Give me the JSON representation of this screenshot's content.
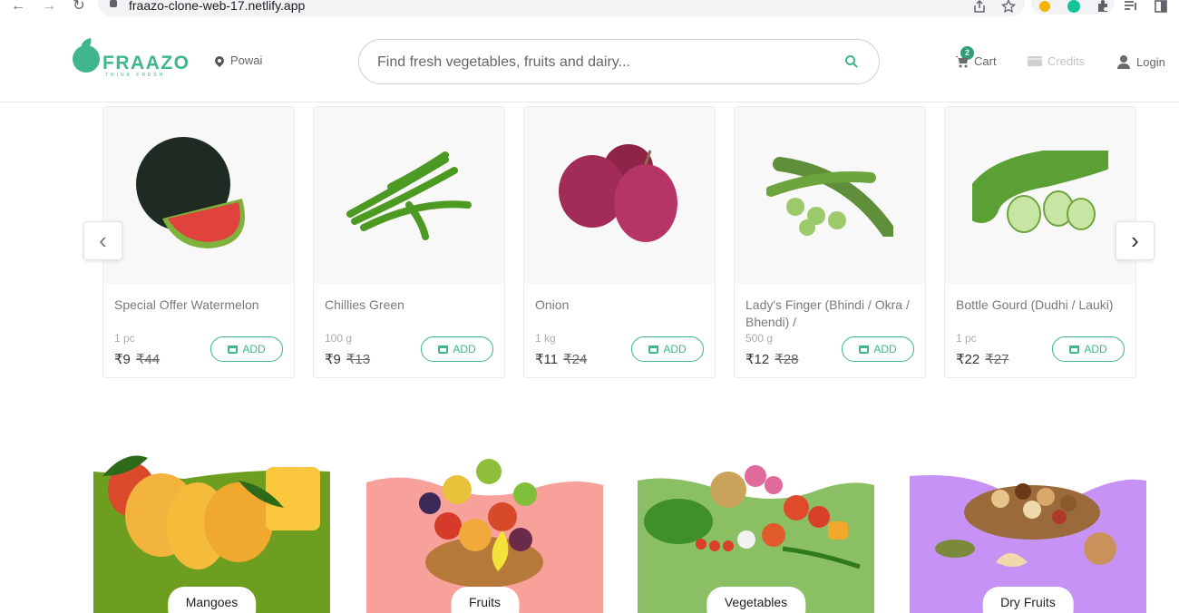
{
  "browser": {
    "url": "fraazo-clone-web-17.netlify.app",
    "back_glyph": "←",
    "forward_glyph": "→",
    "reload_glyph": "↻"
  },
  "header": {
    "brand": "FRAAZO",
    "tagline": "THINK FRESH",
    "location": "Powai",
    "search_placeholder": "Find fresh vegetables, fruits and dairy...",
    "cart_label": "Cart",
    "cart_count": "2",
    "credits_label": "Credits",
    "login_label": "Login",
    "accent": "#3fb68b"
  },
  "carousel": {
    "prev_glyph": "‹",
    "next_glyph": "›",
    "products": [
      {
        "name": "Special Offer Watermelon",
        "qty": "1 pc",
        "price": "₹9",
        "mrp": "₹44",
        "add_label": "ADD"
      },
      {
        "name": "Chillies Green",
        "qty": "100 g",
        "price": "₹9",
        "mrp": "₹13",
        "add_label": "ADD"
      },
      {
        "name": "Onion",
        "qty": "1 kg",
        "price": "₹11",
        "mrp": "₹24",
        "add_label": "ADD"
      },
      {
        "name": "Lady's Finger (Bhindi / Okra / Bhendi) /",
        "qty": "500 g",
        "price": "₹12",
        "mrp": "₹28",
        "add_label": "ADD"
      },
      {
        "name": "Bottle Gourd (Dudhi / Lauki)",
        "qty": "1 pc",
        "price": "₹22",
        "mrp": "₹27",
        "add_label": "ADD"
      }
    ]
  },
  "categories": [
    {
      "label": "Mangoes",
      "color": "#6e9e1f"
    },
    {
      "label": "Fruits",
      "color": "#f8a09a"
    },
    {
      "label": "Vegetables",
      "color": "#8bbf63"
    },
    {
      "label": "Dry Fruits",
      "color": "#c792f5"
    }
  ]
}
